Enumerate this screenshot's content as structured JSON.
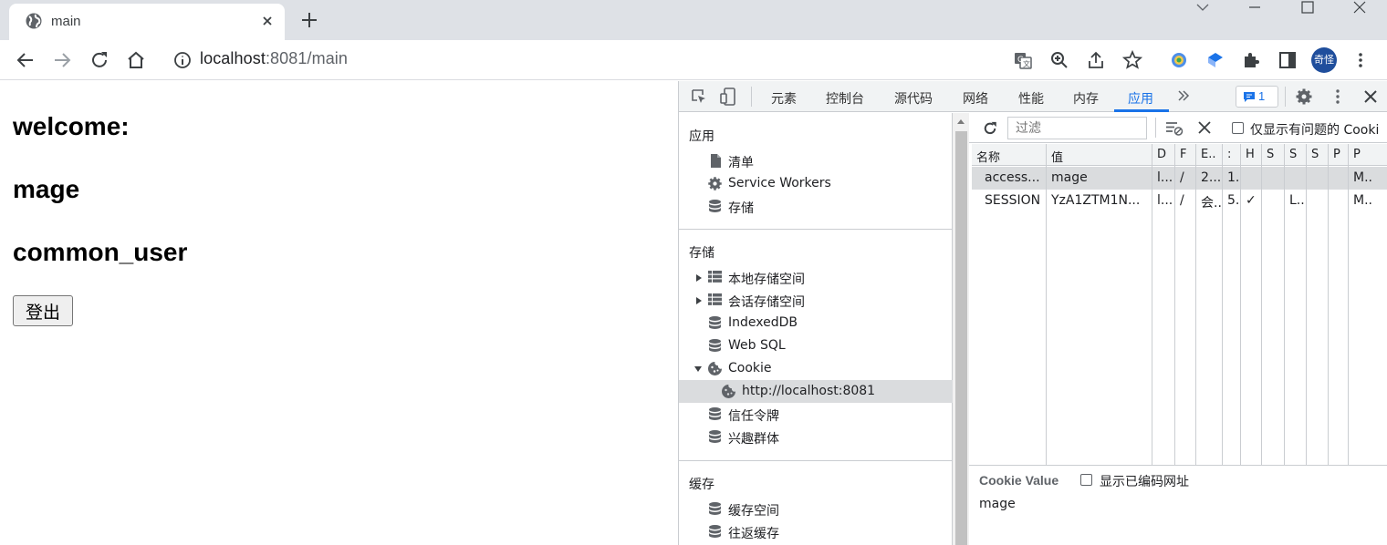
{
  "browser": {
    "tab_title": "main",
    "url_host": "localhost",
    "url_rest": ":8081/main",
    "avatar_text": "奇怪"
  },
  "page": {
    "heading1": "welcome:",
    "heading2": "mage",
    "heading3": "common_user",
    "logout_label": "登出"
  },
  "devtools": {
    "tabs": [
      "元素",
      "控制台",
      "源代码",
      "网络",
      "性能",
      "内存",
      "应用"
    ],
    "active_tab": "应用",
    "issue_count": "1",
    "sidebar": {
      "section_app": "应用",
      "app_items": [
        "清单",
        "Service Workers",
        "存储"
      ],
      "section_storage": "存储",
      "storage_items": [
        "本地存储空间",
        "会话存储空间",
        "IndexedDB",
        "Web SQL",
        "Cookie",
        "http://localhost:8081",
        "信任令牌",
        "兴趣群体"
      ],
      "section_cache": "缓存",
      "cache_items": [
        "缓存空间",
        "往返缓存"
      ]
    },
    "filter_placeholder": "过滤",
    "only_issues_label": "仅显示有问题的 Cooki",
    "columns": [
      "名称",
      "值",
      "D",
      "F",
      "E..",
      ":",
      "H",
      "S",
      "S",
      "S",
      "P",
      "P"
    ],
    "rows": [
      [
        "access...",
        "mage",
        "l...",
        "/",
        "2...",
        "1.",
        "",
        "",
        "",
        "",
        "",
        "M.."
      ],
      [
        "SESSION",
        "YzA1ZTM1N...",
        "l...",
        "/",
        "会...",
        "5.",
        "✓",
        "",
        "L...",
        "",
        "",
        "M.."
      ]
    ],
    "cookie_value_title": "Cookie Value",
    "show_encoded_label": "显示已编码网址",
    "cookie_value": "mage"
  },
  "colors": {
    "accent": "#1a73e8",
    "tabstrip": "#dee1e6",
    "selection": "#dadcde"
  }
}
